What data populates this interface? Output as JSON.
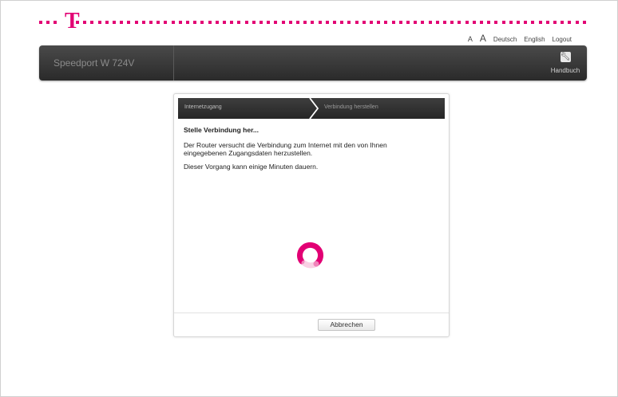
{
  "brand": {
    "logo_letter": "T",
    "accent": "#e20074"
  },
  "topnav": {
    "font_small": "A",
    "font_large": "A",
    "lang_de": "Deutsch",
    "lang_en": "English",
    "logout": "Logout"
  },
  "header": {
    "device_name": "Speedport W 724V",
    "manual_label": "Handbuch",
    "manual_icon": "wrench-icon"
  },
  "steps": [
    "Internetzugang",
    "Verbindung herstellen"
  ],
  "content": {
    "title": "Stelle Verbindung her...",
    "text1": "Der Router versucht die Verbindung zum Internet mit den von Ihnen eingegebenen Zugangsdaten herzustellen.",
    "text2": "Dieser Vorgang kann einige Minuten dauern."
  },
  "footer": {
    "cancel_label": "Abbrechen"
  }
}
